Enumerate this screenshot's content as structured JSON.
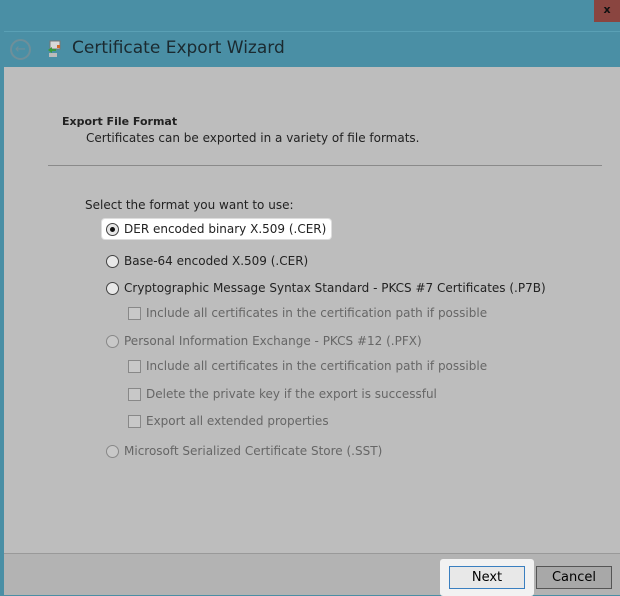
{
  "window": {
    "close_label": "x",
    "title": "Certificate Export Wizard"
  },
  "header": {
    "title": "Export File Format",
    "subtitle": "Certificates can be exported in a variety of file formats."
  },
  "prompt": "Select the format you want to use:",
  "options": [
    {
      "label": "DER encoded binary X.509 (.CER)",
      "selected": true,
      "enabled": true
    },
    {
      "label": "Base-64 encoded X.509 (.CER)",
      "selected": false,
      "enabled": true
    },
    {
      "label": "Cryptographic Message Syntax Standard - PKCS #7 Certificates (.P7B)",
      "selected": false,
      "enabled": true
    },
    {
      "label": "Personal Information Exchange - PKCS #12 (.PFX)",
      "selected": false,
      "enabled": false
    },
    {
      "label": "Microsoft Serialized Certificate Store (.SST)",
      "selected": false,
      "enabled": false
    }
  ],
  "checkboxes": [
    {
      "label": "Include all certificates in the certification path if possible",
      "checked": false,
      "enabled": false
    },
    {
      "label": "Include all certificates in the certification path if possible",
      "checked": false,
      "enabled": false
    },
    {
      "label": "Delete the private key if the export is successful",
      "checked": false,
      "enabled": false
    },
    {
      "label": "Export all extended properties",
      "checked": false,
      "enabled": false
    }
  ],
  "buttons": {
    "next": "Next",
    "cancel": "Cancel"
  }
}
